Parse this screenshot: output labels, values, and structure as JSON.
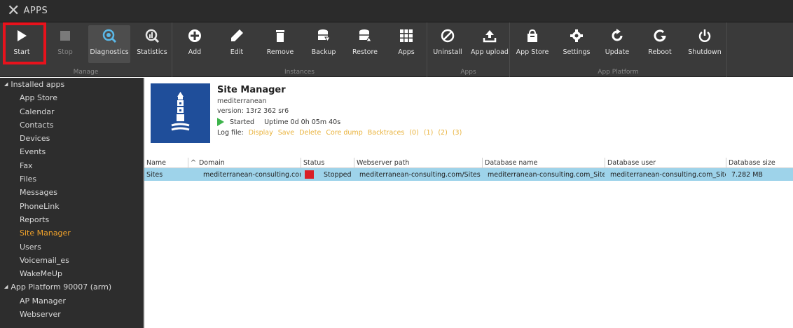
{
  "window": {
    "title": "APPS"
  },
  "ribbon": {
    "groups": {
      "manage": "Manage",
      "instances": "Instances",
      "apps": "Apps",
      "app_platform": "App Platform"
    },
    "buttons": {
      "start": "Start",
      "stop": "Stop",
      "diagnostics": "Diagnostics",
      "statistics": "Statistics",
      "add": "Add",
      "edit": "Edit",
      "remove": "Remove",
      "backup": "Backup",
      "restore": "Restore",
      "apps": "Apps",
      "uninstall": "Uninstall",
      "app_upload": "App upload",
      "app_store": "App Store",
      "settings": "Settings",
      "update": "Update",
      "reboot": "Reboot",
      "shutdown": "Shutdown"
    }
  },
  "sidebar": {
    "installed_apps": "Installed apps",
    "items": [
      "App Store",
      "Calendar",
      "Contacts",
      "Devices",
      "Events",
      "Fax",
      "Files",
      "Messages",
      "PhoneLink",
      "Reports",
      "Site Manager",
      "Users",
      "Voicemail_es",
      "WakeMeUp"
    ],
    "platform": "App Platform 90007 (arm)",
    "platform_items": [
      "AP Manager",
      "Webserver"
    ]
  },
  "app": {
    "name": "Site Manager",
    "vendor": "mediterranean",
    "version": "version: 13r2 362 sr6",
    "state": "Started",
    "uptime": "Uptime 0d 0h 05m 40s",
    "logfile_label": "Log file:",
    "log_links": [
      "Display",
      "Save",
      "Delete",
      "Core dump",
      "Backtraces",
      "(0)",
      "(1)",
      "(2)",
      "(3)"
    ]
  },
  "table": {
    "columns": {
      "name": "Name",
      "domain": "Domain",
      "status": "Status",
      "webserver_path": "Webserver path",
      "db_name": "Database name",
      "db_user": "Database user",
      "db_size": "Database size"
    },
    "sort_indicator": "^",
    "rows": [
      {
        "name": "Sites",
        "domain": "mediterranean-consulting.com",
        "status": "Stopped",
        "webserver_path": "mediterranean-consulting.com/Sites",
        "db_name": "mediterranean-consulting.com_Sites",
        "db_user": "mediterranean-consulting.com_Sites",
        "db_size": "7.282 MB"
      }
    ]
  },
  "colors": {
    "accent": "#f0a22b",
    "highlight_row": "#9ed3ea",
    "status_stopped": "#d91e26",
    "status_started": "#3cb34a",
    "logo_bg": "#1f4e9a"
  }
}
